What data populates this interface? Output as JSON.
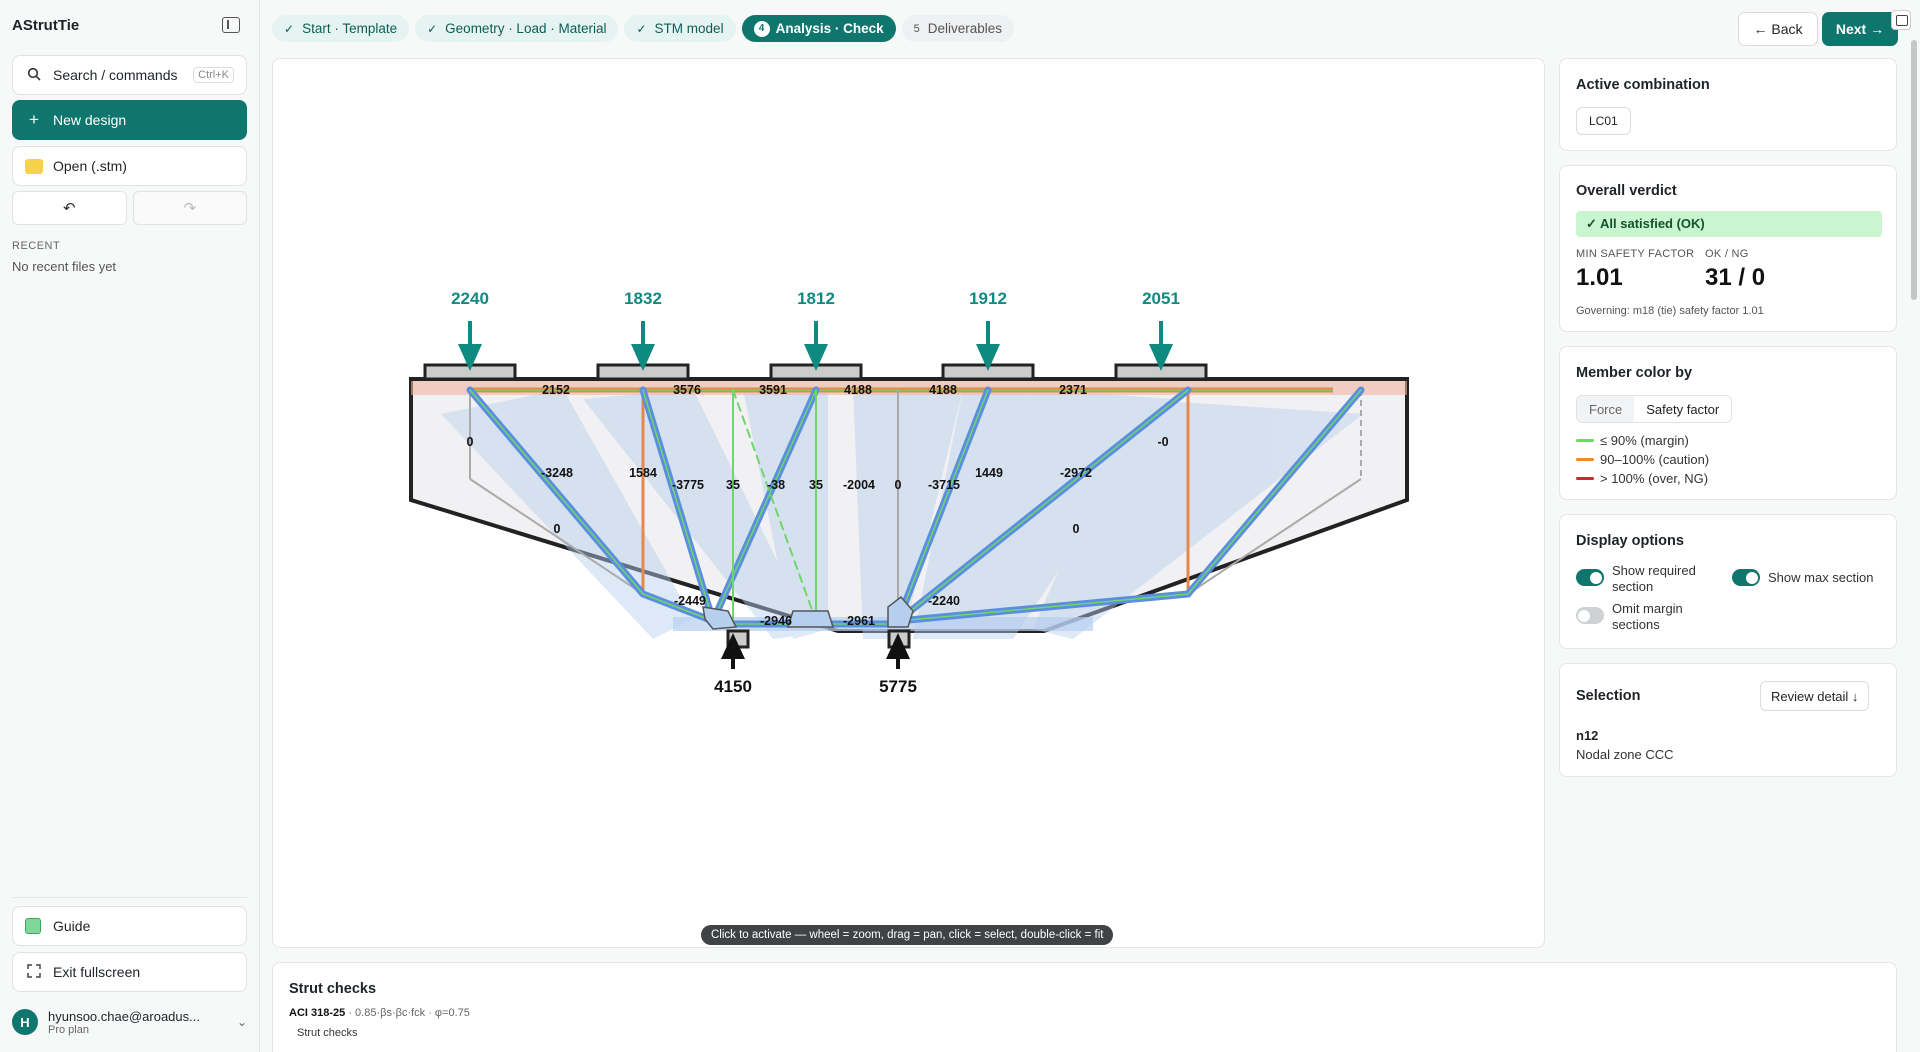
{
  "app": {
    "title": "AStrutTie"
  },
  "sidebar": {
    "search": {
      "label": "Search / commands",
      "shortcut": "Ctrl+K"
    },
    "new_design": "New design",
    "open": "Open (.stm)",
    "recent_label": "RECENT",
    "recent_empty": "No recent files yet",
    "guide": "Guide",
    "exit_fullscreen": "Exit fullscreen",
    "user": {
      "initial": "H",
      "email": "hyunsoo.chae@aroadus...",
      "plan": "Pro plan"
    }
  },
  "steps": [
    {
      "label": "Start · Template",
      "state": "done"
    },
    {
      "label": "Geometry · Load · Material",
      "state": "done"
    },
    {
      "label": "STM model",
      "state": "done"
    },
    {
      "label": "Analysis · Check",
      "state": "active",
      "num": "4"
    },
    {
      "label": "Deliverables",
      "state": "future",
      "num": "5"
    }
  ],
  "nav": {
    "back": "← Back",
    "next": "Next →"
  },
  "model": {
    "top_loads": [
      "2240",
      "1832",
      "1812",
      "1912",
      "2051"
    ],
    "reactions": [
      "4150",
      "5775"
    ],
    "tie_forces_top": [
      "2152",
      "3576",
      "3591",
      "4188",
      "4188",
      "2371"
    ],
    "member_forces": [
      "0",
      "-3248",
      "1584",
      "-3775",
      "35",
      "-38",
      "35",
      "-2004",
      "0",
      "-3715",
      "1449",
      "-2972",
      "-0",
      "0",
      "-2449",
      "-2946",
      "-2961",
      "-2240",
      "0"
    ],
    "colors": {
      "load": "#0f8a80",
      "tie": "#e8874a",
      "strut": "#5b8de0",
      "margin": "#6fd66a",
      "zone": "#b7cfee"
    }
  },
  "canvas_hint": "Click to activate — wheel = zoom, drag = pan, click = select, double-click = fit",
  "panel": {
    "active_combination": {
      "title": "Active combination",
      "value": "LC01"
    },
    "verdict": {
      "title": "Overall verdict",
      "status": "✓ All satisfied (OK)",
      "min_sf_label": "MIN SAFETY FACTOR",
      "min_sf": "1.01",
      "okng_label": "OK / NG",
      "okng": "31 / 0",
      "governing": "Governing: m18 (tie) safety factor 1.01"
    },
    "member_color": {
      "title": "Member color by",
      "options": [
        "Force",
        "Safety factor"
      ],
      "selected": "Safety factor",
      "legend": [
        {
          "label": "≤ 90% (margin)",
          "color": "#6fd66a"
        },
        {
          "label": "90–100% (caution)",
          "color": "#f08a2a"
        },
        {
          "label": "> 100% (over, NG)",
          "color": "#e0202a"
        }
      ]
    },
    "display": {
      "title": "Display options",
      "show_required": {
        "label": "Show required section",
        "on": true
      },
      "show_max": {
        "label": "Show max section",
        "on": true
      },
      "omit_margin": {
        "label": "Omit margin sections",
        "on": false
      }
    },
    "selection": {
      "title": "Selection",
      "review": "Review detail ↓",
      "id": "n12",
      "desc": "Nodal zone CCC"
    }
  },
  "checks": {
    "title": "Strut checks",
    "code": "ACI 318-25",
    "code_detail": " · 0.85·βs·βc·fck · φ=0.75",
    "sub": "Strut checks"
  }
}
